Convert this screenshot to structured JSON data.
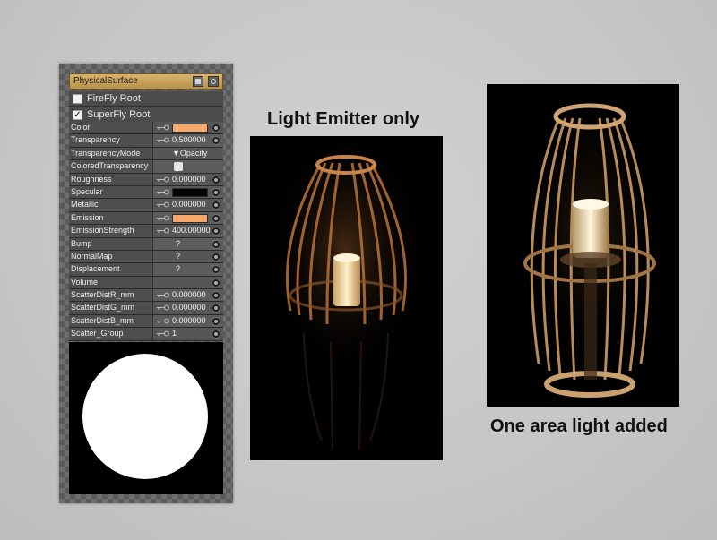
{
  "panel": {
    "title": "PhysicalSurface",
    "roots": [
      {
        "label": "FireFly Root",
        "checked": false
      },
      {
        "label": "SuperFly Root",
        "checked": true
      }
    ],
    "params": [
      {
        "name": "Color",
        "kind": "swatch",
        "color": "#f5a869",
        "key": true
      },
      {
        "name": "Transparency",
        "kind": "value",
        "value": "0.500000",
        "key": true
      },
      {
        "name": "TransparencyMode",
        "kind": "value",
        "value": "▼Opacity",
        "key": false
      },
      {
        "name": "ColoredTransparency",
        "kind": "check",
        "key": false
      },
      {
        "name": "Roughness",
        "kind": "value",
        "value": "0.000000",
        "key": true
      },
      {
        "name": "Specular",
        "kind": "swatch",
        "color": "#050505",
        "key": true
      },
      {
        "name": "Metallic",
        "kind": "value",
        "value": "0.000000",
        "key": true
      },
      {
        "name": "Emission",
        "kind": "swatch",
        "color": "#f5a869",
        "key": true
      },
      {
        "name": "EmissionStrength",
        "kind": "value",
        "value": "400.00000",
        "key": true
      },
      {
        "name": "Bump",
        "kind": "value",
        "value": "?",
        "key": false
      },
      {
        "name": "NormalMap",
        "kind": "value",
        "value": "?",
        "key": false
      },
      {
        "name": "Displacement",
        "kind": "value",
        "value": "?",
        "key": false
      },
      {
        "name": "Volume",
        "kind": "empty",
        "key": false
      },
      {
        "name": "ScatterDistR_mm",
        "kind": "value",
        "value": "0.000000",
        "key": true
      },
      {
        "name": "ScatterDistG_mm",
        "kind": "value",
        "value": "0.000000",
        "key": true
      },
      {
        "name": "ScatterDistB_mm",
        "kind": "value",
        "value": "0.000000",
        "key": true
      },
      {
        "name": "Scatter_Group",
        "kind": "value",
        "value": "1",
        "key": true
      }
    ]
  },
  "renders": {
    "left_caption": "Light Emitter only",
    "right_caption": "One area light added"
  },
  "colors": {
    "panel_header": "#c9a35a",
    "emission_swatch": "#f5a869"
  }
}
